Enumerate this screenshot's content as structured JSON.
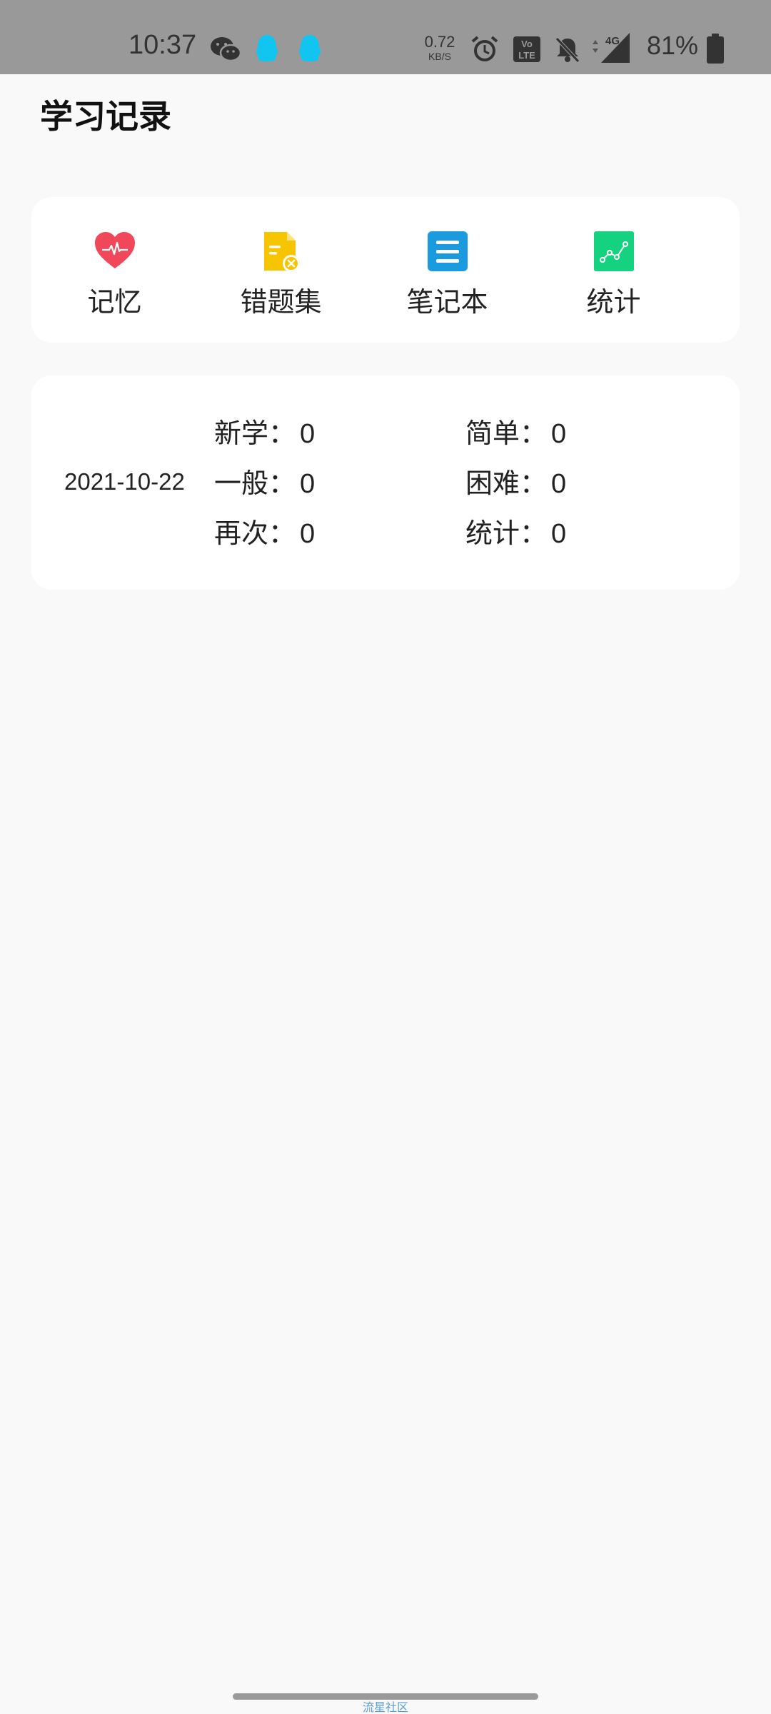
{
  "status_bar": {
    "time": "10:37",
    "net_speed_value": "0.72",
    "net_speed_unit": "KB/S",
    "network": "4G",
    "battery_percent": "81%",
    "icons": [
      "wechat-icon",
      "qq-icon",
      "qq-icon",
      "alarm-icon",
      "volte-icon",
      "mute-icon",
      "signal-icon",
      "battery-icon"
    ]
  },
  "header": {
    "title": "学习记录"
  },
  "quick_actions": [
    {
      "label": "记忆",
      "icon": "heart-pulse-icon",
      "color": "#f0485a"
    },
    {
      "label": "错题集",
      "icon": "wrong-doc-icon",
      "color": "#f7c400"
    },
    {
      "label": "笔记本",
      "icon": "notebook-icon",
      "color": "#1a9be0"
    },
    {
      "label": "统计",
      "icon": "chart-line-icon",
      "color": "#14d27f"
    }
  ],
  "record": {
    "date": "2021-10-22",
    "stats": [
      {
        "label": "新学：",
        "value": "0"
      },
      {
        "label": "简单：",
        "value": "0"
      },
      {
        "label": "一般：",
        "value": "0"
      },
      {
        "label": "困难：",
        "value": "0"
      },
      {
        "label": "再次：",
        "value": "0"
      },
      {
        "label": "统计：",
        "value": "0"
      }
    ]
  },
  "watermark": "流星社区"
}
